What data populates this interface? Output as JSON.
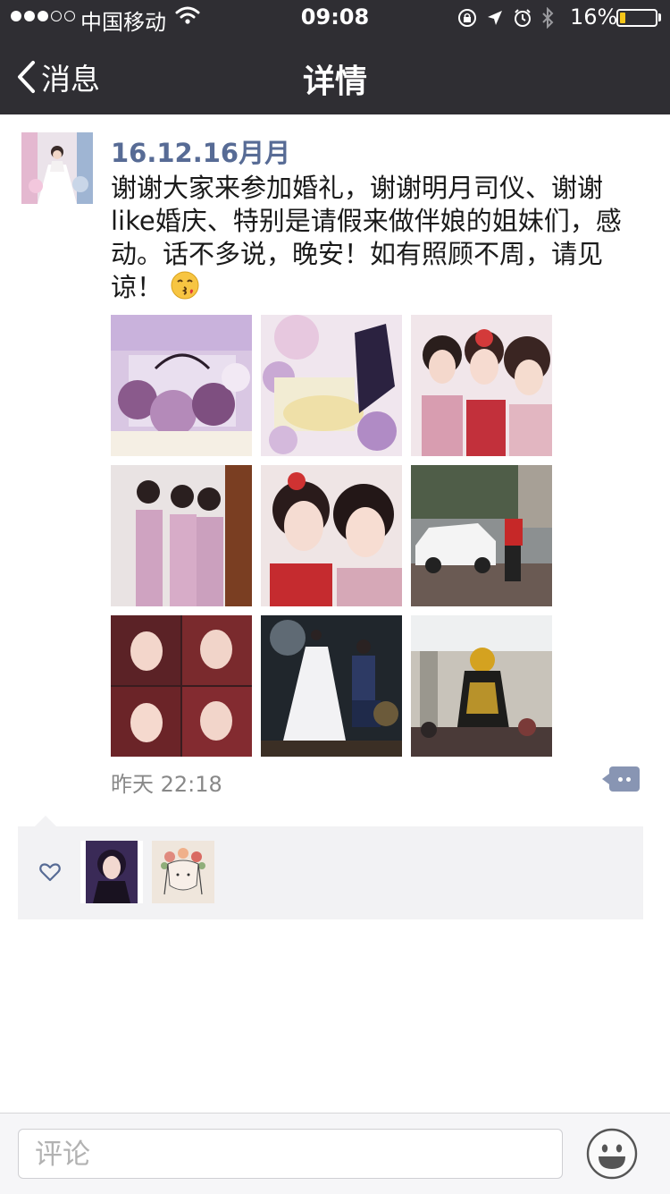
{
  "status_bar": {
    "carrier": "中国移动",
    "time": "09:08",
    "battery": "16%",
    "battery_level": 0.16
  },
  "nav": {
    "back_label": "消息",
    "title": "详情"
  },
  "post": {
    "author": "16.12.16月月",
    "text": "谢谢大家来参加婚礼，谢谢明月司仪、谢谢like婚庆、特别是请假来做伴娘的姐妹们，感动。话不多说，晚安！如有照顾不周，请见谅！",
    "emoji": "kissing-face-emoji",
    "time": "昨天 22:18",
    "photos": [
      {
        "name": "photo-1",
        "subject": "wedding-stage-decoration"
      },
      {
        "name": "photo-2",
        "subject": "wedding-table-flowers"
      },
      {
        "name": "photo-3",
        "subject": "bride-and-bridesmaids-selfie"
      },
      {
        "name": "photo-4",
        "subject": "bridesmaids-pink-dresses"
      },
      {
        "name": "photo-5",
        "subject": "bride-and-friend-selfie"
      },
      {
        "name": "photo-6",
        "subject": "wedding-car"
      },
      {
        "name": "photo-7",
        "subject": "friends-collage"
      },
      {
        "name": "photo-8",
        "subject": "proposal-on-stage"
      },
      {
        "name": "photo-9",
        "subject": "face-changing-performer"
      }
    ]
  },
  "likes": {
    "users": [
      {
        "name": "liker-avatar-1"
      },
      {
        "name": "liker-avatar-2"
      }
    ]
  },
  "comment_bar": {
    "placeholder": "评论"
  },
  "colors": {
    "nav_bg": "#2f2e33",
    "link_blue": "#576b95",
    "likes_bg": "#f2f2f4",
    "comment_button": "#8895b3"
  }
}
